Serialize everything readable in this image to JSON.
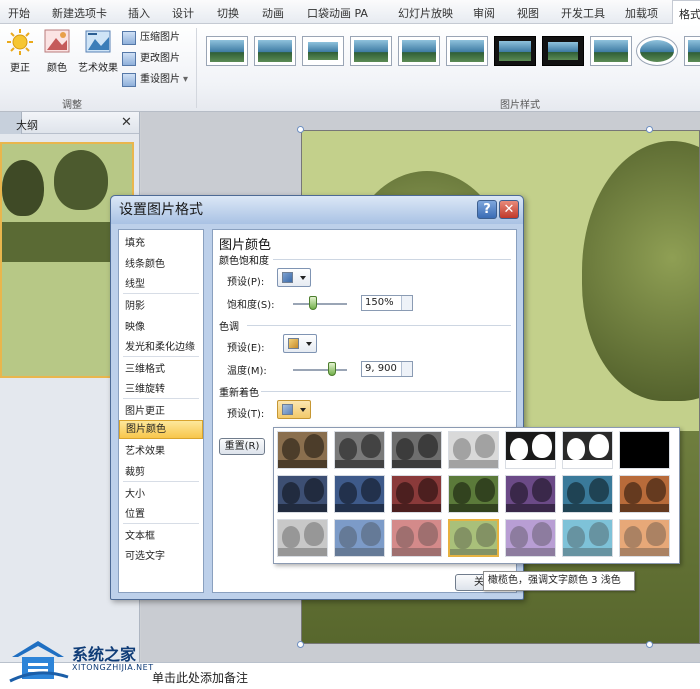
{
  "ribbon_tabs": [
    "开始",
    "新建选项卡",
    "插入",
    "设计",
    "切换",
    "动画",
    "口袋动画 PA",
    "幻灯片放映",
    "审阅",
    "视图",
    "开发工具",
    "加载项",
    "格式"
  ],
  "adjust": {
    "corrections": "更正",
    "color": "颜色",
    "artistic": "艺术效果",
    "compress": "压缩图片",
    "change": "更改图片",
    "reset": "重设图片",
    "group": "调整"
  },
  "styles": {
    "group": "图片样式"
  },
  "left_pane": {
    "tab_outline": "大纲",
    "close": "✕"
  },
  "dialog": {
    "title": "设置图片格式",
    "help": "?",
    "close": "✕",
    "nav": [
      "填充",
      "线条颜色",
      "线型",
      "阴影",
      "映像",
      "发光和柔化边缘",
      "三维格式",
      "三维旋转",
      "图片更正",
      "图片颜色",
      "艺术效果",
      "裁剪",
      "大小",
      "位置",
      "文本框",
      "可选文字"
    ],
    "selected_nav": "图片颜色",
    "heading": "图片颜色",
    "saturation": {
      "section": "颜色饱和度",
      "preset_label": "预设(P):",
      "amount_label": "饱和度(S):",
      "value": "150%",
      "slider_level": 0.37
    },
    "tone": {
      "section": "色调",
      "preset_label": "预设(E):",
      "temp_label": "温度(M):",
      "value": "9, 900",
      "slider_level": 0.72
    },
    "recolor": {
      "section": "重新着色",
      "preset_label": "预设(T):"
    },
    "reset_btn": "重置(R)",
    "close_btn": "关"
  },
  "tooltip": "橄榄色，强调文字颜色 3 浅色",
  "notes_placeholder": "单击此处添加备注",
  "watermark": {
    "name": "系统之家",
    "url": "XITONGZHIJIA.NET"
  },
  "colors": {
    "gallery": [
      [
        "#8a6f4e",
        "#7a7a7a",
        "#6e6e6e",
        "#d9d9d9",
        "#1a1a1a",
        "#2a2a2a",
        "#000000"
      ],
      [
        "#3d4f73",
        "#3e5a8a",
        "#8a3a3a",
        "#5b7a3a",
        "#6b4a87",
        "#3a7a9a",
        "#b86b3a"
      ],
      [
        "#c8c8c8",
        "#7c9bc8",
        "#d48a8a",
        "#a9c07a",
        "#b89ed4",
        "#7ec2d8",
        "#e7a878"
      ]
    ],
    "accent": "#e6b241"
  }
}
